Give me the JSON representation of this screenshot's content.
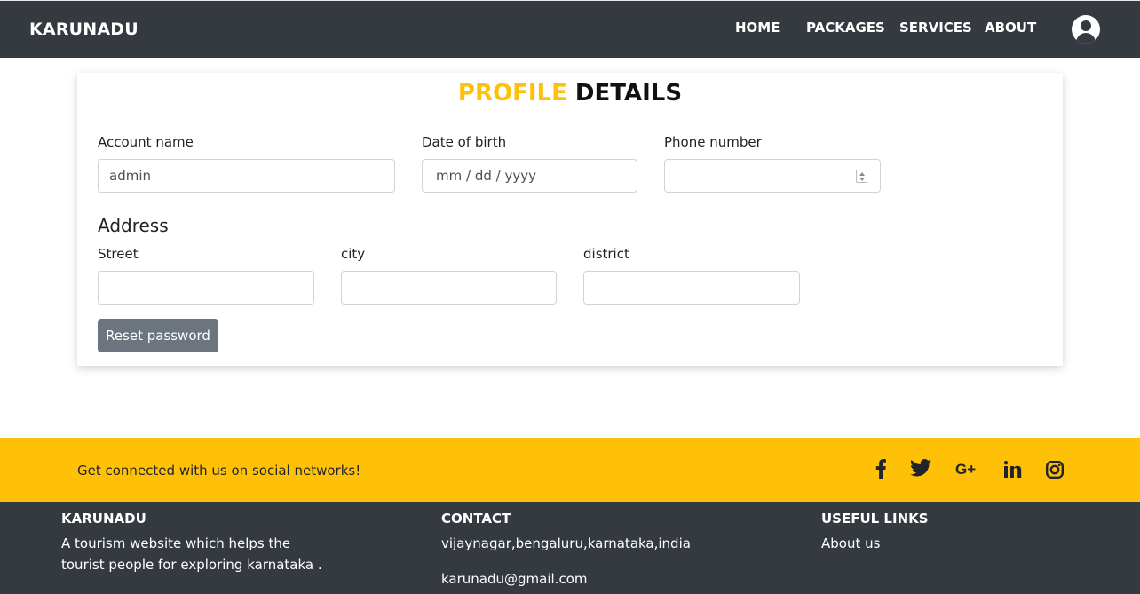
{
  "navbar": {
    "brand": "KARUNADU",
    "links": [
      "HOME",
      "PACKAGES",
      "SERVICES",
      "ABOUT"
    ],
    "avatar_icon": "user-circle-icon"
  },
  "profile": {
    "title_accent": "PROFILE",
    "title_main": "DETAILS",
    "account_name_label": "Account name",
    "account_name_value": "admin",
    "dob_label": "Date of birth",
    "dob_placeholder": "mm / dd / yyyy",
    "phone_label": "Phone number",
    "phone_value": "",
    "address_heading": "Address",
    "street_label": "Street",
    "city_label": "city",
    "district_label": "district",
    "reset_button": "Reset password"
  },
  "social": {
    "text": "Get connected with us on social networks!",
    "icons": [
      "facebook-icon",
      "twitter-icon",
      "google-plus-icon",
      "linkedin-icon",
      "instagram-icon"
    ]
  },
  "footer": {
    "col1_heading": "KARUNADU",
    "col1_line1": "A tourism website which helps the",
    "col1_line2": "tourist people for exploring karnataka .",
    "col2_heading": "CONTACT",
    "col2_address": "vijaynagar,bengaluru,karnataka,india",
    "col2_email": "karunadu@gmail.com",
    "col3_heading": "USEFUL LINKS",
    "col3_link1": "About us"
  },
  "colors": {
    "navbar_bg": "#343a40",
    "accent": "#ffc107",
    "button_secondary": "#6c757d"
  }
}
